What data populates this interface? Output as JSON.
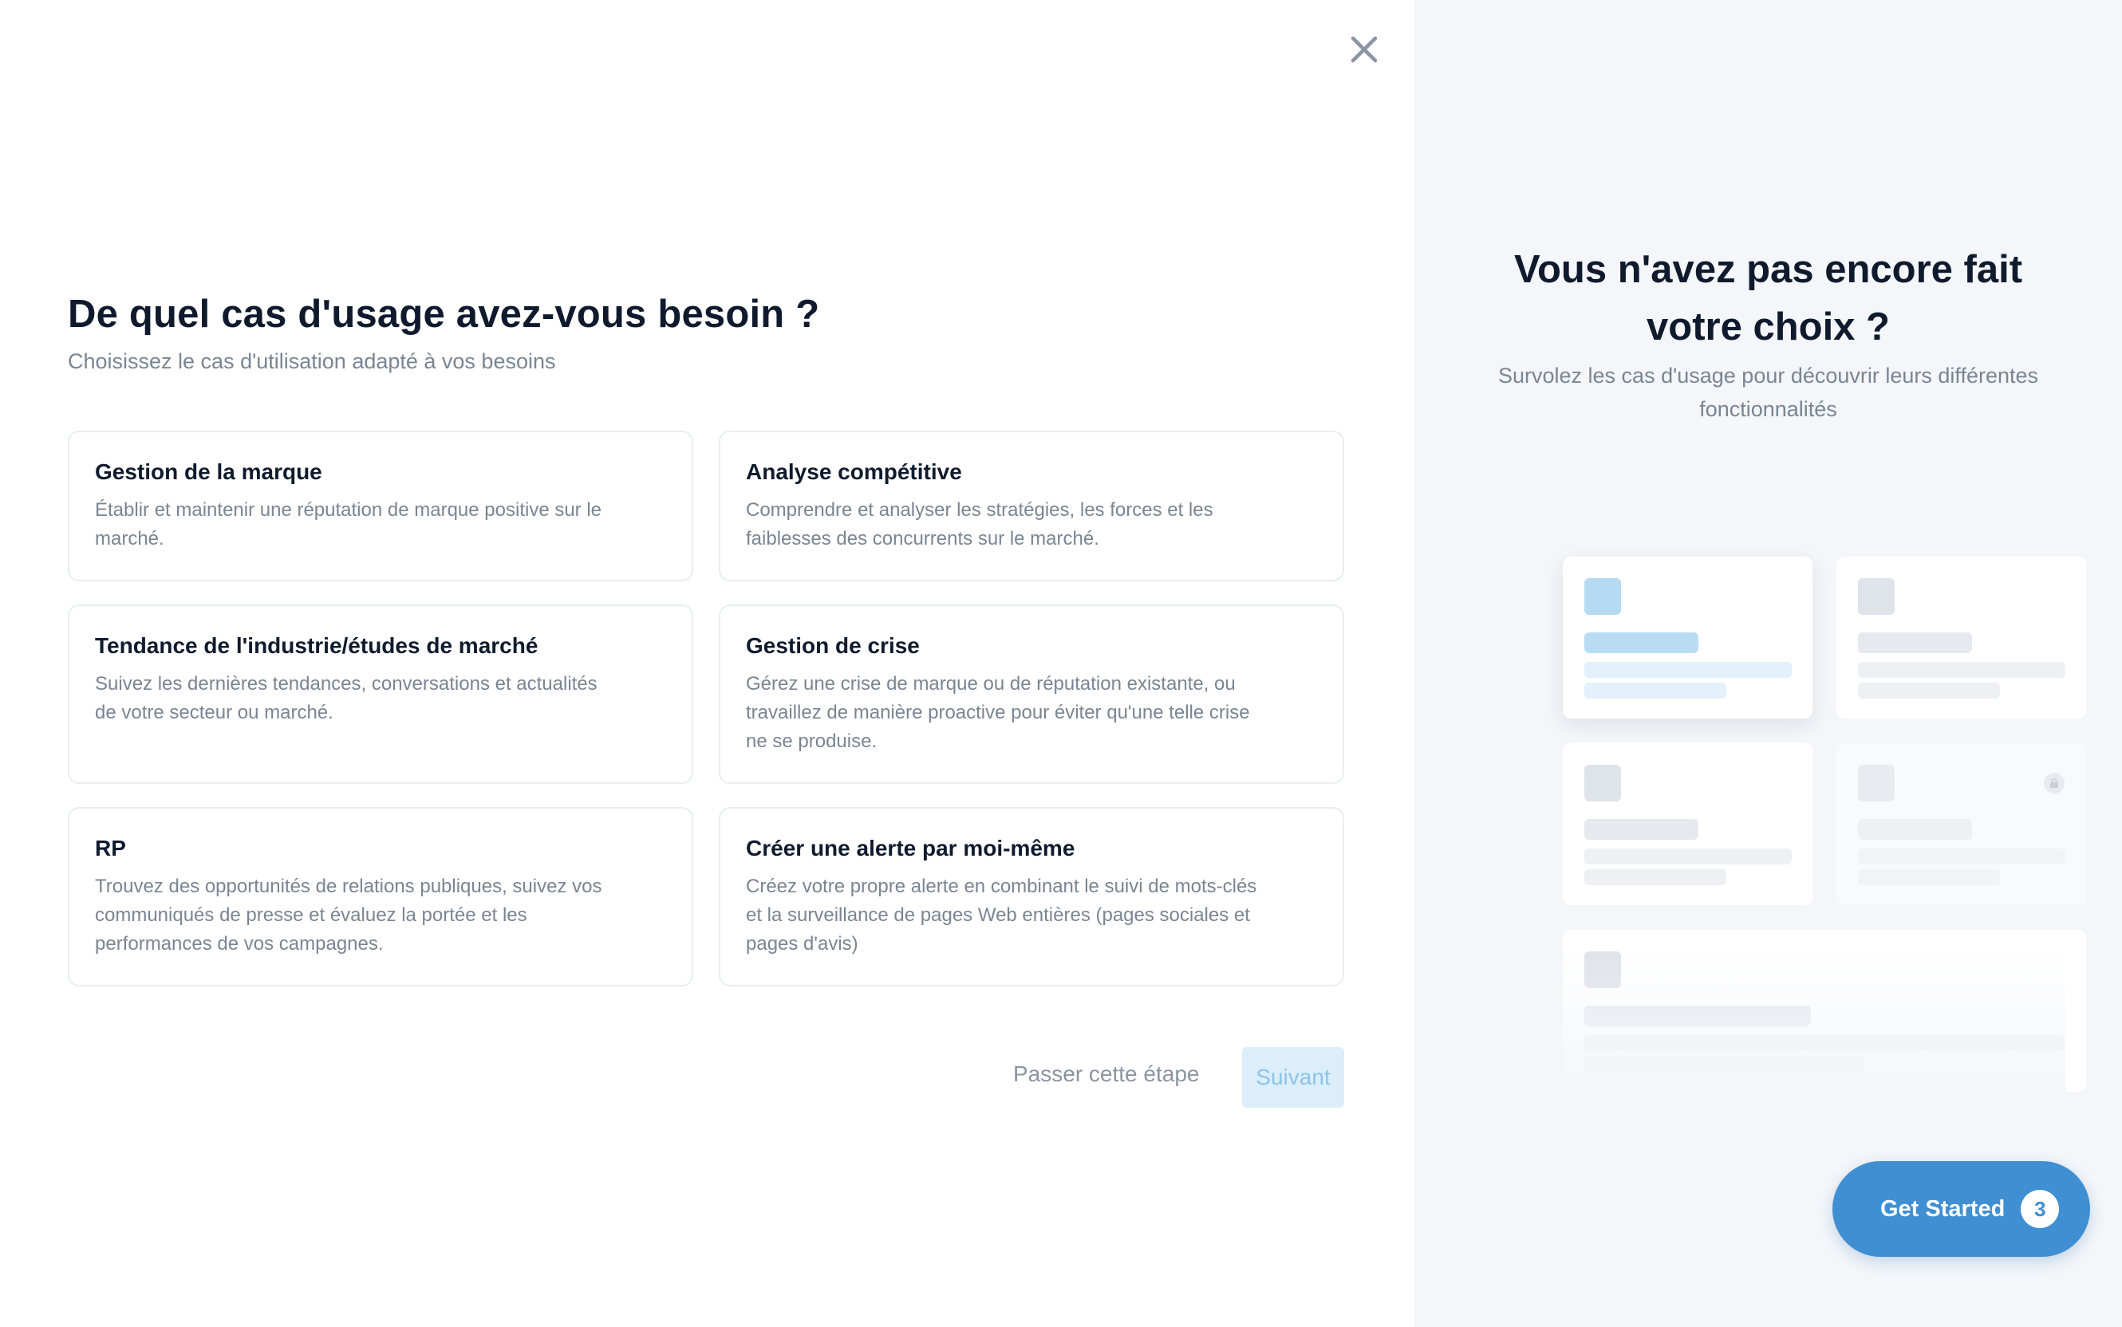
{
  "dialog": {
    "title": "De quel cas d'usage avez-vous besoin ?",
    "subtitle": "Choisissez le cas d'utilisation adapté à vos besoins",
    "use_cases": [
      {
        "title": "Gestion de la marque",
        "description": "Établir et maintenir une réputation de marque positive sur le marché."
      },
      {
        "title": "Analyse compétitive",
        "description": "Comprendre et analyser les stratégies, les forces et les faiblesses des concurrents sur le marché."
      },
      {
        "title": "Tendance de l'industrie/études de marché",
        "description": "Suivez les dernières tendances, conversations et actualités de votre secteur ou marché."
      },
      {
        "title": "Gestion de crise",
        "description": "Gérez une crise de marque ou de réputation existante, ou travaillez de manière proactive pour éviter qu'une telle crise ne se produise."
      },
      {
        "title": "RP",
        "description": "Trouvez des opportunités de relations publiques, suivez vos communiqués de presse et évaluez la portée et les performances de vos campagnes."
      },
      {
        "title": "Créer une alerte par moi-même",
        "description": "Créez votre propre alerte en combinant le suivi de mots-clés et la surveillance de pages Web entières (pages sociales et pages d'avis)"
      }
    ],
    "skip_label": "Passer cette étape",
    "next_label": "Suivant",
    "close_icon": "close-icon"
  },
  "side_panel": {
    "title": "Vous n'avez pas encore fait votre choix ?",
    "subtitle": "Survolez les cas d'usage pour découvrir leurs différentes fonctionnalités"
  },
  "get_started": {
    "label": "Get Started",
    "count": "3"
  },
  "colors": {
    "accent": "#3f8fd2",
    "next_disabled_bg": "#dbeefa",
    "right_panel_bg": "#f4f6f9"
  }
}
